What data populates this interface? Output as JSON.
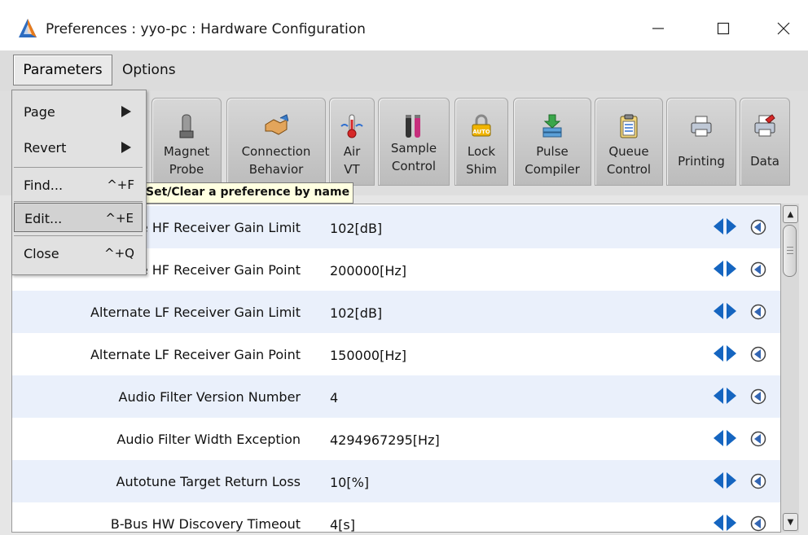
{
  "window": {
    "title": "Preferences : yyo-pc : Hardware Configuration",
    "minimize_glyph": "—",
    "maximize_glyph": "☐",
    "close_glyph": "✕"
  },
  "menubar": {
    "items": [
      "Parameters",
      "Options"
    ]
  },
  "parameters_menu": {
    "items": [
      {
        "label": "Page",
        "shortcut": "",
        "submenu": true
      },
      {
        "label": "Revert",
        "shortcut": "",
        "submenu": true
      },
      {
        "label": "Find...",
        "shortcut": "^+F",
        "submenu": false
      },
      {
        "label": "Edit...",
        "shortcut": "^+E",
        "submenu": false
      },
      {
        "label": "Close",
        "shortcut": "^+Q",
        "submenu": false
      }
    ]
  },
  "tooltip": "Set/Clear a preference by name",
  "toolbar": {
    "tabs": [
      {
        "label": "Magnet\nProbe",
        "icon": "magnet-probe-icon"
      },
      {
        "label": "Connection\nBehavior",
        "icon": "handshake-icon"
      },
      {
        "label": "Air\nVT",
        "icon": "thermometer-icon"
      },
      {
        "label": "Sample\nControl",
        "icon": "sample-tubes-icon"
      },
      {
        "label": "Lock\nShim",
        "icon": "auto-lock-icon"
      },
      {
        "label": "Pulse\nCompiler",
        "icon": "download-stack-icon"
      },
      {
        "label": "Queue\nControl",
        "icon": "clipboard-icon"
      },
      {
        "label": "Printing",
        "icon": "printer-icon"
      },
      {
        "label": "Data",
        "icon": "data-printer-icon"
      }
    ]
  },
  "preferences": {
    "rows": [
      {
        "name": "Alternate HF Receiver Gain Limit",
        "value": "102[dB]"
      },
      {
        "name": "Alternate HF Receiver Gain Point",
        "value": "200000[Hz]"
      },
      {
        "name": "Alternate LF Receiver Gain Limit",
        "value": "102[dB]"
      },
      {
        "name": "Alternate LF Receiver Gain Point",
        "value": "150000[Hz]"
      },
      {
        "name": "Audio Filter Version Number",
        "value": "4"
      },
      {
        "name": "Audio Filter Width Exception",
        "value": "4294967295[Hz]"
      },
      {
        "name": "Autotune Target Return Loss",
        "value": "10[%]"
      },
      {
        "name": "B-Bus HW Discovery Timeout",
        "value": "4[s]"
      }
    ]
  },
  "scrollbar": {
    "up_glyph": "▲",
    "down_glyph": "▼"
  },
  "colors": {
    "row_alt": "#eaf0fb",
    "arrow_blue": "#1565c0",
    "tooltip_bg": "#ffffe1"
  }
}
